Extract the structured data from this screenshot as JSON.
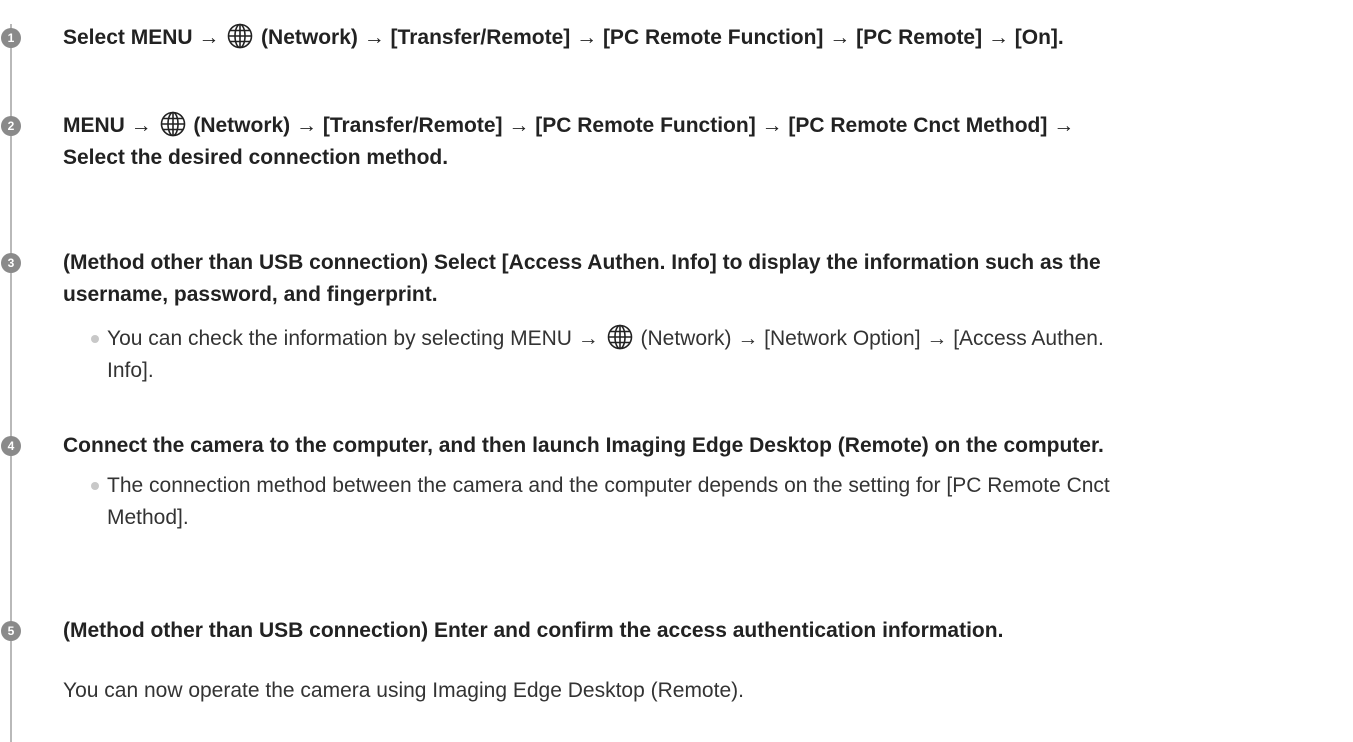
{
  "steps": [
    {
      "number": "1",
      "title_before": "Select MENU → ",
      "title_after": " (Network) → [Transfer/Remote] → [PC Remote Function] → [PC Remote] → [On]."
    },
    {
      "number": "2",
      "title_before": "MENU → ",
      "title_line1_after": " (Network) → [Transfer/Remote] → [PC Remote Function] → [PC Remote Cnct Method] →",
      "title_line2": "Select the desired connection method."
    },
    {
      "number": "3",
      "title_line1": "(Method other than USB connection) Select [Access Authen. Info] to display the information such as the",
      "title_line2": "username, password, and fingerprint.",
      "note_before": "You can check the information by selecting MENU → ",
      "note_after": " (Network) → [Network Option] → [Access Authen.",
      "note_line2": "Info]."
    },
    {
      "number": "4",
      "title": "Connect the camera to the computer, and then launch Imaging Edge Desktop (Remote) on the computer.",
      "note_line1": "The connection method between the camera and the computer depends on the setting for [PC Remote Cnct",
      "note_line2": "Method]."
    },
    {
      "number": "5",
      "title": "(Method other than USB connection) Enter and confirm the access authentication information.",
      "result": "You can now operate the camera using Imaging Edge Desktop (Remote)."
    }
  ],
  "icons": {
    "network": "globe-icon"
  },
  "colors": {
    "step_circle": "#8a8a8a",
    "timeline": "#b9b9b9",
    "bullet": "#c8c8c8",
    "text": "#222222"
  }
}
